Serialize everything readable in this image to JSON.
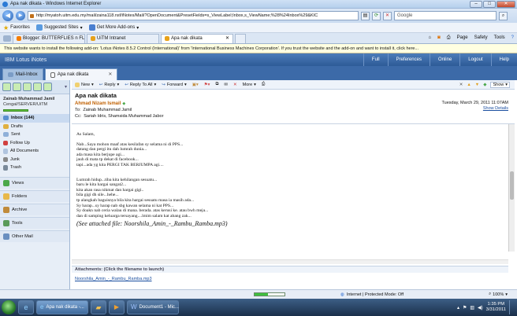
{
  "browser": {
    "title": "Apa nak dikata - Windows Internet Explorer",
    "url": "http://myatoh.uitm.edu.my/mail/zaina118.nsf/iNotes/Mail/?OpenDocument&PresetFields=s_ViewLabel;Inbox,s_ViewName;%28%24Inbox%29&KIC",
    "search_placeholder": "Google",
    "favorites_label": "Favorites",
    "suggested_sites": "Suggested Sites",
    "get_more_addons": "Get More Add-ons",
    "tabs": [
      {
        "label": "Blogger: BUTTERFLIES n FL..."
      },
      {
        "label": "UiTM Intranet"
      },
      {
        "label": "Apa nak dikata"
      }
    ],
    "commands": {
      "page": "Page",
      "safety": "Safety",
      "tools": "Tools"
    },
    "info_bar": "This website wants to install the following add-on: 'Lotus iNotes 8.5.2 Control (International)' from 'International Business Machines Corporation'. If you trust the website and the add-on and want to install it, click here..."
  },
  "app": {
    "brand": "IBM Lotus iNotes",
    "header_links": [
      "Full",
      "Preferences",
      "Online",
      "Logout",
      "Help"
    ],
    "tabs": [
      {
        "label": "Mail-Inbox"
      },
      {
        "label": "Apa nak dikata"
      }
    ]
  },
  "nav": {
    "user_name": "Zainab Muhammad Jamil",
    "user_server": "Cengal/SERVER/UiTM",
    "folders": [
      {
        "label": "Inbox (144)"
      },
      {
        "label": "Drafts"
      },
      {
        "label": "Sent"
      },
      {
        "label": "Follow Up"
      },
      {
        "label": "All Documents"
      },
      {
        "label": "Junk"
      },
      {
        "label": "Trash"
      }
    ],
    "sections": [
      {
        "label": "Views"
      },
      {
        "label": "Folders"
      },
      {
        "label": "Archive"
      },
      {
        "label": "Tools"
      },
      {
        "label": "Other Mail"
      }
    ]
  },
  "toolbar": {
    "new": "New",
    "reply": "Reply",
    "reply_all": "Reply To All",
    "forward": "Forward",
    "more": "More",
    "show": "Show"
  },
  "message": {
    "subject": "Apa nak dikata",
    "from": "Ahmad Nizam Ismail",
    "date": "Tuesday, March 29, 2011 11:07AM",
    "show_details": "Show Details",
    "to_label": "To:",
    "to": "Zainab Muhammad Jamil",
    "cc_label": "Cc:",
    "cc": "Sariah Idris, Shamsida Muhammad Jabor",
    "greeting": "As Salam,",
    "para1": [
      "Nab...Saya mohon maaf atas kesilafan sy selama ni di PPS...",
      "datang dan pergi itu dah lumrah dunia...",
      "ada masa kita berjupe agi...",
      "jauh di mata tp dekat di facebook...",
      "tapi...ada yg kita PERGI TAK BERJUMPA agi...."
    ],
    "para2": [
      "Lumrah hidup...tiba kita kehilangan sesuatu...",
      "baru le kita hargai sangat2...",
      "kita akan rasa nikmat dan hargai gigi..",
      "bila gigi dh sile...hehe...",
      "tp alangkah baguisnya bila kita hargai sesuatu masa ia masih ada...",
      "Sy harap...sy harap nab sbg kawan selama ni kat PPS...",
      "Sy doakn nab ceria walau di mana. berada. atas kerusi ke. atau bwh meja...",
      "dan di samping keluarga tersayang....lmim salam kat abang zak..."
    ],
    "attached_note": "(See attached file: Noorshila_Amin_-_Rambu_Ramba.mp3)",
    "attachments_label": "Attachments: (Click the filename to launch)",
    "attachment_file": "Noorshila_Amin_-_Rambu_Ramba.mp3"
  },
  "status": {
    "zone": "Internet | Protected Mode: Off",
    "zoom": "100%",
    "progress": 0.45
  },
  "taskbar": {
    "items": [
      {
        "label": "Apa nak dikata -..."
      },
      {
        "label": "Document1 - Mic..."
      }
    ],
    "time": "1:35 PM",
    "date": "3/31/2011"
  }
}
